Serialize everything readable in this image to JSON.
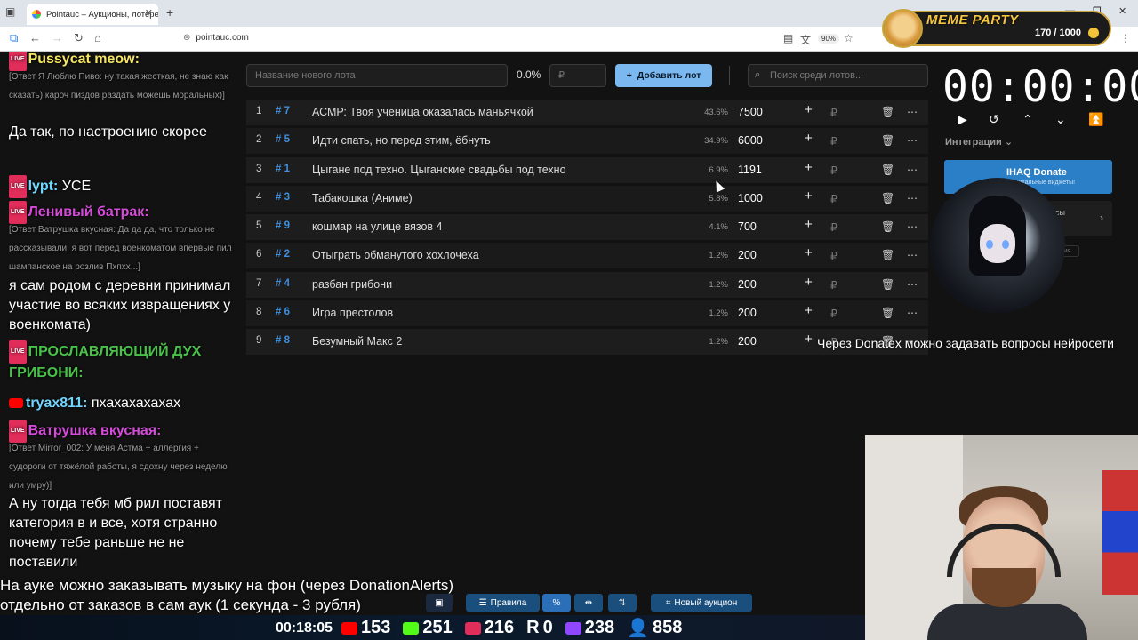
{
  "browser": {
    "tab_title": "Pointauc – Аукционы, лотереи",
    "url": "pointauc.com",
    "zoom": "90%"
  },
  "overlay": {
    "brand": "MEME PARTY",
    "points": "170 / 1000"
  },
  "chat": {
    "messages": [
      {
        "user": "Pussycat meow:",
        "text": "",
        "color": "#f5e663"
      },
      {
        "user": "",
        "text": "[Ответ Я Люблю Пиво: ну такая жесткая, не знаю как сказать) кароч пиздов раздать можешь моральных)]",
        "small": true
      },
      {
        "user": "",
        "text": "Да так, по настроению скорее"
      },
      {
        "user": "lypt:",
        "text": "УСЕ",
        "color": "#6fd6ff"
      },
      {
        "user": "Ленивый батрак:",
        "text": "",
        "color": "#d64bd9"
      },
      {
        "user": "",
        "text": "[Ответ Ватрушка вкусная: Да да да, что только не рассказывали, я вот перед военкоматом впервые пил шампанское на розлив Пхпхх...]",
        "small": true
      },
      {
        "user": "",
        "text": "я сам родом с деревни принимал участие во всяких извращениях у военкомата)"
      },
      {
        "user": "ПРОСЛАВЛЯЮЩИЙ ДУХ ГРИБОНИ:",
        "text": "",
        "color": "#49c24a"
      },
      {
        "user": "tryax811:",
        "text": "пхахахахахах",
        "color": "#6fd6ff"
      },
      {
        "user": "Ватрушка вкусная:",
        "text": "",
        "color": "#d64bd9"
      },
      {
        "user": "",
        "text": "[Ответ Mirror_002: У меня Астма + аллергия + судороги от тяжёлой работы, я сдохну через неделю или умру)]",
        "small": true
      },
      {
        "user": "",
        "text": "А ну тогда тебя мб рил поставят категория в и все, хотя странно почему тебе раньше не не поставили"
      }
    ]
  },
  "app": {
    "lot_placeholder": "Название нового лота",
    "total_pct": "0.0%",
    "rub_placeholder": "₽",
    "add_button": "Добавить лот",
    "search_placeholder": "Поиск среди лотов...",
    "lots": [
      {
        "n": "1",
        "id": "# 7",
        "name": "АСМР: Твоя ученица оказалась маньячкой",
        "pct": "43.6%",
        "amount": "7500"
      },
      {
        "n": "2",
        "id": "# 5",
        "name": "Идти спать, но перед этим, ёбнуть",
        "pct": "34.9%",
        "amount": "6000"
      },
      {
        "n": "3",
        "id": "# 1",
        "name": "Цыгане под техно. Цыганские свадьбы под техно",
        "pct": "6.9%",
        "amount": "1191"
      },
      {
        "n": "4",
        "id": "# 3",
        "name": "Табакошка (Аниме)",
        "pct": "5.8%",
        "amount": "1000"
      },
      {
        "n": "5",
        "id": "# 9",
        "name": "кошмар на улице вязов 4",
        "pct": "4.1%",
        "amount": "700"
      },
      {
        "n": "6",
        "id": "# 2",
        "name": "Отыграть обманутого хохлочеха",
        "pct": "1.2%",
        "amount": "200"
      },
      {
        "n": "7",
        "id": "# 4",
        "name": "разбан грибони",
        "pct": "1.2%",
        "amount": "200"
      },
      {
        "n": "8",
        "id": "# 6",
        "name": "Игра престолов",
        "pct": "1.2%",
        "amount": "200"
      },
      {
        "n": "9",
        "id": "# 8",
        "name": "Безумный Макс 2",
        "pct": "1.2%",
        "amount": "200"
      }
    ],
    "timer": "00:00:00",
    "integrations": "Интеграции",
    "donate_title": "IHAQ Donate",
    "donate_sub": "уникальные виджеты!",
    "card2_text": "исы",
    "card3_text": "ория",
    "rules": "Правила",
    "new_auction": "Новый аукцион"
  },
  "tts": "Через Donatex можно задавать вопросы нейросети",
  "subtitles": [
    "На ауке можно заказывать музыку на фон (через DonationAlerts)",
    "отдельно от заказов в сам аук (1 секунда - 3 рубля)"
  ],
  "stream_stats": {
    "time": "00:18:05",
    "youtube": "153",
    "kick": "251",
    "vk": "216",
    "r": "0",
    "twitch": "238",
    "viewers": "858"
  }
}
